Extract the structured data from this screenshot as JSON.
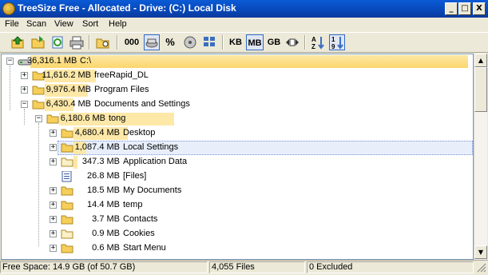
{
  "window": {
    "title": "TreeSize Free - Allocated - Drive: (C:) Local Disk",
    "minimize_glyph": "_",
    "maximize_glyph": "□",
    "close_glyph": "X"
  },
  "menu": [
    "File",
    "Scan",
    "View",
    "Sort",
    "Help"
  ],
  "toolbar": {
    "kb_label": "KB",
    "mb_label": "MB",
    "gb_label": "GB",
    "percent_label": "%",
    "digits_label": "000",
    "active_unit": "MB"
  },
  "tree": {
    "rows": [
      {
        "size": "36,316.1 MB",
        "name": "C:\\",
        "fill_pct": 100
      },
      {
        "size": "11,616.2 MB",
        "name": "freeRapid_DL",
        "fill_pct": 32
      },
      {
        "size": "9,976.4 MB",
        "name": "Program Files",
        "fill_pct": 27
      },
      {
        "size": "6,430.4 MB",
        "name": "Documents and Settings",
        "fill_pct": 18
      },
      {
        "size": "6,180.6 MB",
        "name": "tong",
        "fill_pct": 96
      },
      {
        "size": "4,680.4 MB",
        "name": "Desktop",
        "fill_pct": 76
      },
      {
        "size": "1,087.4 MB",
        "name": "Local Settings",
        "fill_pct": 18
      },
      {
        "size": "347.3 MB",
        "name": "Application Data",
        "fill_pct": 6
      },
      {
        "size": "26.8 MB",
        "name": "[Files]",
        "fill_pct": 0
      },
      {
        "size": "18.5 MB",
        "name": "My Documents",
        "fill_pct": 0
      },
      {
        "size": "14.4 MB",
        "name": "temp",
        "fill_pct": 0
      },
      {
        "size": "3.7 MB",
        "name": "Contacts",
        "fill_pct": 0
      },
      {
        "size": "0.9 MB",
        "name": "Cookies",
        "fill_pct": 0
      },
      {
        "size": "0.6 MB",
        "name": "Start Menu",
        "fill_pct": 0
      }
    ],
    "expander_plus": "+",
    "expander_minus": "−"
  },
  "status": {
    "free_space": "Free Space: 14.9 GB  (of 50.7 GB)",
    "files": "4,055  Files",
    "excluded": "0 Excluded"
  },
  "colors": {
    "bar": "#fde8a8",
    "folder": "#f5cf5a",
    "title_bar": "#0a5bd6"
  }
}
